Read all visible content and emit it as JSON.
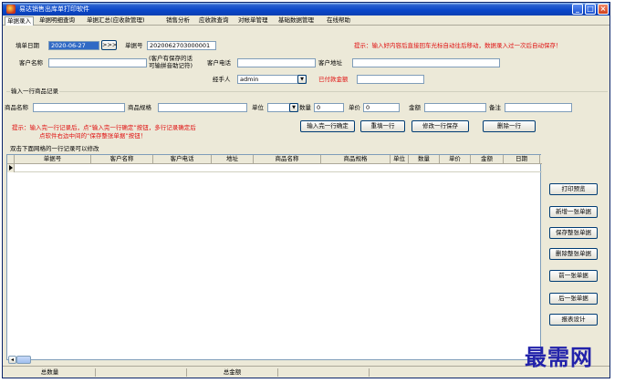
{
  "window": {
    "title": "易达销售出库单打印软件",
    "controls": {
      "minimize": "_",
      "maximize": "□",
      "close": "×"
    }
  },
  "tabs": [
    {
      "label": "单据录入"
    },
    {
      "label": "单据明细查询"
    },
    {
      "label": "单据汇总(应收款管理)"
    },
    {
      "label": "销售分析"
    },
    {
      "label": "应收款查询"
    },
    {
      "label": "对帐单管理"
    },
    {
      "label": "基础数据管理"
    },
    {
      "label": "在线帮助"
    }
  ],
  "header": {
    "date_label": "填单日期",
    "date_value": "2020-06-27",
    "date_button": ">>>",
    "docno_label": "单据号",
    "docno_value": "2020062703000001",
    "hint": "提示：输入好内容后直接回车光标自动往后移动，数据录入过一次后自动保存！",
    "customer_name_label": "客户名称",
    "customer_name_value": "",
    "customer_note_line1": "(客户有保存的话",
    "customer_note_line2": "可输拼音助记符)",
    "customer_phone_label": "客户电话",
    "customer_phone_value": "",
    "customer_address_label": "客户地址",
    "customer_address_value": "",
    "handler_label": "经手人",
    "handler_value": "admin",
    "paid_label": "已付款金额",
    "paid_value": ""
  },
  "line_entry": {
    "section_title": "输入一行商品记录",
    "product_name_label": "商品名称",
    "product_spec_label": "商品规格",
    "unit_label": "单位",
    "qty_label": "数量",
    "qty_value": "0",
    "price_label": "单价",
    "price_value": "0",
    "amount_label": "金额",
    "remark_label": "备注",
    "hint_line1": "提示：输入完一行记录后，点“输入完一行确定”按钮，多行记录确定后",
    "hint_line2": "点软件右边中间的“保存整张单据”按钮！",
    "btn_confirm": "输入完一行确定",
    "btn_reset": "重填一行",
    "btn_save_row": "修改一行保存",
    "btn_delete_row": "删除一行"
  },
  "grid": {
    "caption": "双击下面网格的一行记录可以修改",
    "columns": [
      "单据号",
      "客户名称",
      "客户电话",
      "地址",
      "商品名称",
      "商品规格",
      "单位",
      "数量",
      "单价",
      "金额",
      "日期"
    ]
  },
  "side_buttons": [
    {
      "label": "打印预览"
    },
    {
      "label": "新增一张单据"
    },
    {
      "label": "保存整张单据"
    },
    {
      "label": "删除整张单据"
    },
    {
      "label": "前一张单据"
    },
    {
      "label": "后一张单据"
    },
    {
      "label": "报表设计"
    }
  ],
  "statusbar": {
    "total_qty_label": "总数量",
    "total_amount_label": "总金额"
  },
  "watermark": "最需网"
}
